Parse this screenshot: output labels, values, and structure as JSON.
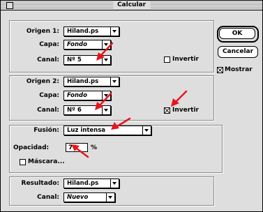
{
  "window": {
    "title": "Calcular"
  },
  "source1": {
    "label": "Origen 1:",
    "file": "Hiland.ps",
    "layer_label": "Capa:",
    "layer": "Fondo",
    "channel_label": "Canal:",
    "channel": "Nº 5",
    "invert_label": "Invertir",
    "invert_checked": false
  },
  "source2": {
    "label": "Origen 2:",
    "file": "Hiland.ps",
    "layer_label": "Capa:",
    "layer": "Fondo",
    "channel_label": "Canal:",
    "channel": "Nº 6",
    "invert_label": "Invertir",
    "invert_checked": true
  },
  "blending": {
    "label": "Fusión:",
    "mode": "Luz intensa",
    "opacity_label": "Opacidad:",
    "opacity": "70",
    "opacity_unit": "%",
    "mask_label": "Máscara...",
    "mask_checked": false
  },
  "result": {
    "label": "Resultado:",
    "file": "Hiland.ps",
    "channel_label": "Canal:",
    "channel": "Nuevo"
  },
  "buttons": {
    "ok": "OK",
    "cancel": "Cancelar"
  },
  "preview": {
    "label": "Mostrar",
    "checked": true
  },
  "annotation_color": "#e8141c"
}
